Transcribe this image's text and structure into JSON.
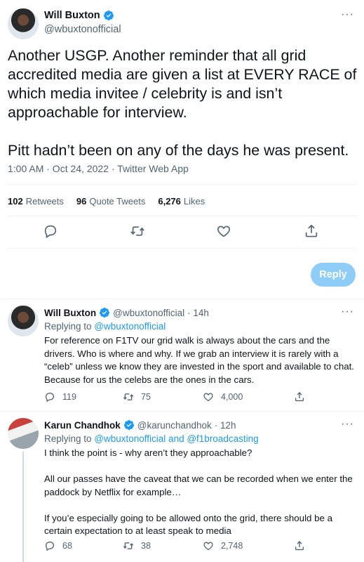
{
  "main_tweet": {
    "author_name": "Will Buxton",
    "author_handle": "@wbuxtonofficial",
    "text": "Another USGP. Another reminder that all grid accredited media are given a list at EVERY RACE of which media invitee / celebrity is and isn’t approachable for interview.\n\nPitt hadn’t been on any of the days he was present.",
    "timestamp": "1:00 AM · Oct 24, 2022 · Twitter Web App",
    "stats": {
      "retweets_count": "102",
      "retweets_label": "Retweets",
      "quotes_count": "96",
      "quotes_label": "Quote Tweets",
      "likes_count": "6,276",
      "likes_label": "Likes"
    },
    "actions": [
      "reply-icon",
      "retweet-icon",
      "like-icon",
      "share-icon"
    ]
  },
  "reply_composer": {
    "button_label": "Reply",
    "accent": "#1d9bf0"
  },
  "replies": [
    {
      "author_name": "Will Buxton",
      "author_handle": "@wbuxtonofficial",
      "time": "· 14h",
      "replying_prefix": "Replying to ",
      "replying_to": "@wbuxtonofficial",
      "text": "For reference on F1TV our grid walk is always about the cars and the drivers. Who is where and why. If we grab an interview it is rarely with a “celeb” unless we know they are invested in the sport and available to chat. Because for us the celebs are the ones in the cars.",
      "reply_count": "119",
      "retweet_count": "75",
      "like_count": "4,000"
    },
    {
      "author_name": "Karun Chandhok",
      "author_handle": "@karunchandhok",
      "time": "· 12h",
      "replying_prefix": "Replying to ",
      "replying_to": "@wbuxtonofficial and @f1broadcasting",
      "text": "I think the point is - why aren’t they approachable?\n\nAll our passes have the caveat that we can be recorded when we enter the paddock by Netflix for example…\n\nIf you’e especially going to be allowed onto the grid, there should be a certain expectation to at least speak to media",
      "reply_count": "68",
      "retweet_count": "38",
      "like_count": "2,748"
    }
  ],
  "colors": {
    "text": "#0f1419",
    "secondary": "#536471",
    "link": "#1d9bf0",
    "divider": "#eff3f4"
  }
}
